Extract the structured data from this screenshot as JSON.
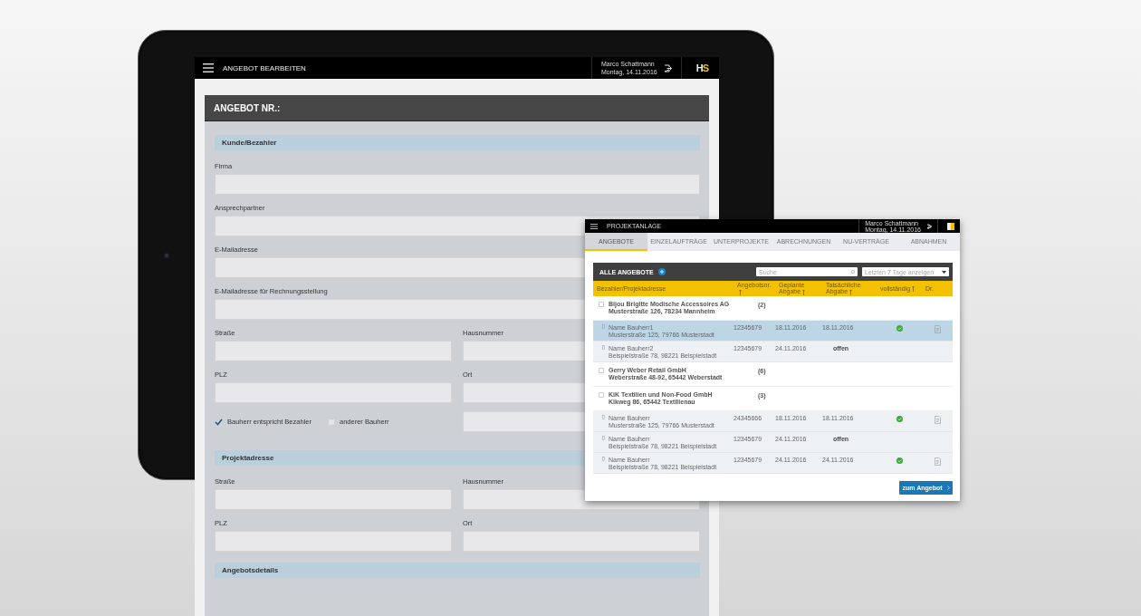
{
  "form_screen": {
    "topbar": {
      "title": "ANGEBOT BEARBEITEN",
      "user": "Marco Schattmann",
      "date": "Montag, 14.11.2016",
      "logo": "HS"
    },
    "card": {
      "title": "ANGEBOT NR.:",
      "sections": [
        {
          "title": "Kunde/Bezahler",
          "rows": [
            {
              "kind": "full",
              "fields": [
                {
                  "label": "Firma"
                }
              ]
            },
            {
              "kind": "full",
              "fields": [
                {
                  "label": "Ansprechpartner"
                }
              ]
            },
            {
              "kind": "full",
              "fields": [
                {
                  "label": "E-Mailadresse"
                }
              ]
            },
            {
              "kind": "full",
              "fields": [
                {
                  "label": "E-Mailadresse für Rechnungsstellung"
                }
              ]
            },
            {
              "kind": "split",
              "fields": [
                {
                  "label": "Straße"
                },
                {
                  "label": "Hausnummer"
                }
              ]
            },
            {
              "kind": "split",
              "fields": [
                {
                  "label": "PLZ"
                },
                {
                  "label": "Ort"
                }
              ]
            },
            {
              "kind": "options",
              "options": [
                {
                  "label": "Bauherr entspricht Bezahler",
                  "checked": true
                },
                {
                  "label": "anderer Bauherr",
                  "checked": false
                }
              ]
            }
          ]
        },
        {
          "title": "Projektadresse",
          "rows": [
            {
              "kind": "split",
              "fields": [
                {
                  "label": "Straße"
                },
                {
                  "label": "Hausnummer"
                }
              ]
            },
            {
              "kind": "split",
              "fields": [
                {
                  "label": "PLZ"
                },
                {
                  "label": "Ort"
                }
              ]
            }
          ]
        },
        {
          "title": "Angebotsdetails"
        }
      ]
    }
  },
  "overview_window": {
    "topbar": {
      "title": "PROJEKTANLAGE",
      "user": "Marco Schattmann",
      "date": "Montag, 14.11.2016"
    },
    "tabs": [
      {
        "label": "ANGEBOTE",
        "selected": true
      },
      {
        "label": "EINZELAUFTRÄGE",
        "selected": false
      },
      {
        "label": "UNTERPROJEKTE",
        "selected": false
      },
      {
        "label": "ABRECHNUNGEN",
        "selected": false
      },
      {
        "label": "NU-VERTRÄGE",
        "selected": false
      },
      {
        "label": "ABNAHMEN",
        "selected": false
      }
    ],
    "panel": {
      "title": "ALLE ANGEBOTE",
      "search": {
        "placeholder": "Suche"
      },
      "filter": "Letzten 7 Tage anzeigen",
      "columns": [
        {
          "label": "Bezahler/Projektadresse",
          "sortable": false
        },
        {
          "label": "Angebotsnr.",
          "sortable": true
        },
        {
          "label": "Geplante Abgabe",
          "sortable": true
        },
        {
          "label": "Tatsächliche Abgabe",
          "sortable": true
        },
        {
          "label": "vollständig",
          "sortable": true
        },
        {
          "label": "Dr.",
          "sortable": false
        }
      ],
      "groups": [
        {
          "name": "Bijou Brigitte Modische Accessoires AG",
          "address": "Musterstraße 126, 78234 Mannheim",
          "count": "(2)",
          "checked": false,
          "children": [
            {
              "name": "Name Bauherr1",
              "address": "Musterstraße 125, 79766 Musterstadt",
              "number": "12345679",
              "planned": "18.11.2016",
              "actual": "18.11.2016",
              "complete": true,
              "selected": true
            },
            {
              "name": "Name Bauherr2",
              "address": "Beispielstraße 78, 98221 Beispielstadt",
              "number": "12345679",
              "planned": "24.11.2016",
              "actual": "offen",
              "complete": false,
              "selected": false
            }
          ]
        },
        {
          "name": "Gerry Weber Retail GmbH",
          "address": "Weberstraße 48-92, 65442 Weberstadt",
          "count": "(6)",
          "checked": false
        },
        {
          "name": "KiK Textilien und Non-Food GmbH",
          "address": "Kikweg 86, 65442 Textilienau",
          "count": "(3)",
          "checked": false,
          "children": [
            {
              "name": "Name Bauherr",
              "address": "Musterstraße 125, 79766 Musterstadt",
              "number": "24345666",
              "planned": "18.11.2016",
              "actual": "18.11.2016",
              "complete": true,
              "selected": false
            },
            {
              "name": "Name Bauherr",
              "address": "Beispielstraße 78, 98221 Beispielstadt",
              "number": "12345679",
              "planned": "24.11.2016",
              "actual": "offen",
              "complete": false,
              "selected": false
            },
            {
              "name": "Name Bauherr",
              "address": "Beispielstraße 78, 98221 Beispielstadt",
              "number": "12345679",
              "planned": "24.11.2016",
              "actual": "24.11.2016",
              "complete": true,
              "selected": false
            }
          ]
        }
      ],
      "button": "zum Angebot"
    }
  }
}
